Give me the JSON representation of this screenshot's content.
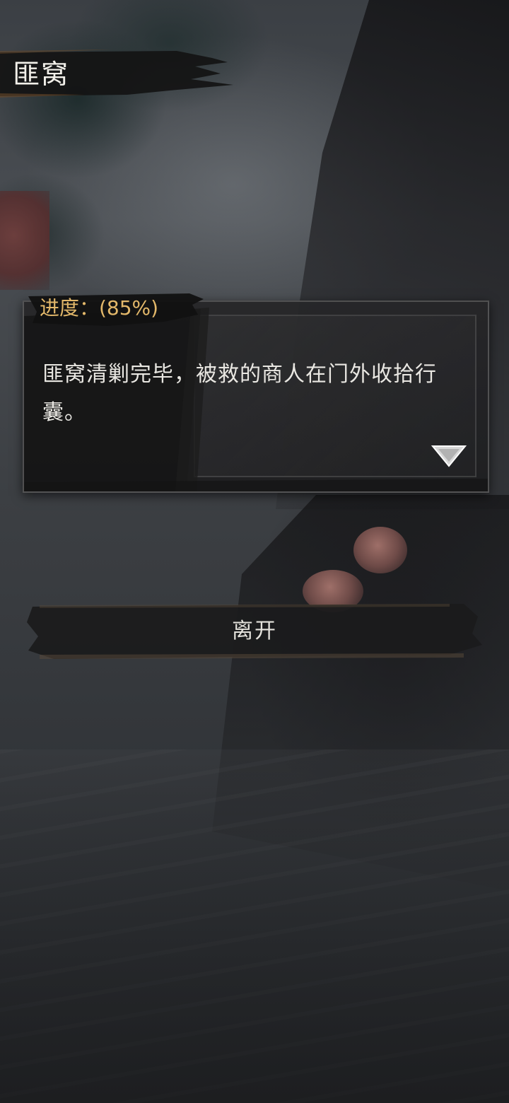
{
  "header": {
    "title": "匪窝"
  },
  "dialog": {
    "progress_label": "进度：(85%)",
    "progress_value": 85,
    "text": "匪窝清剿完毕，被救的商人在门外收拾行囊。",
    "continue_icon": "triangle-down-icon"
  },
  "actions": {
    "leave_label": "离开"
  },
  "colors": {
    "progress_text": "#e3b86a",
    "body_text": "#e9e7e2",
    "panel_bg": "#262628"
  }
}
